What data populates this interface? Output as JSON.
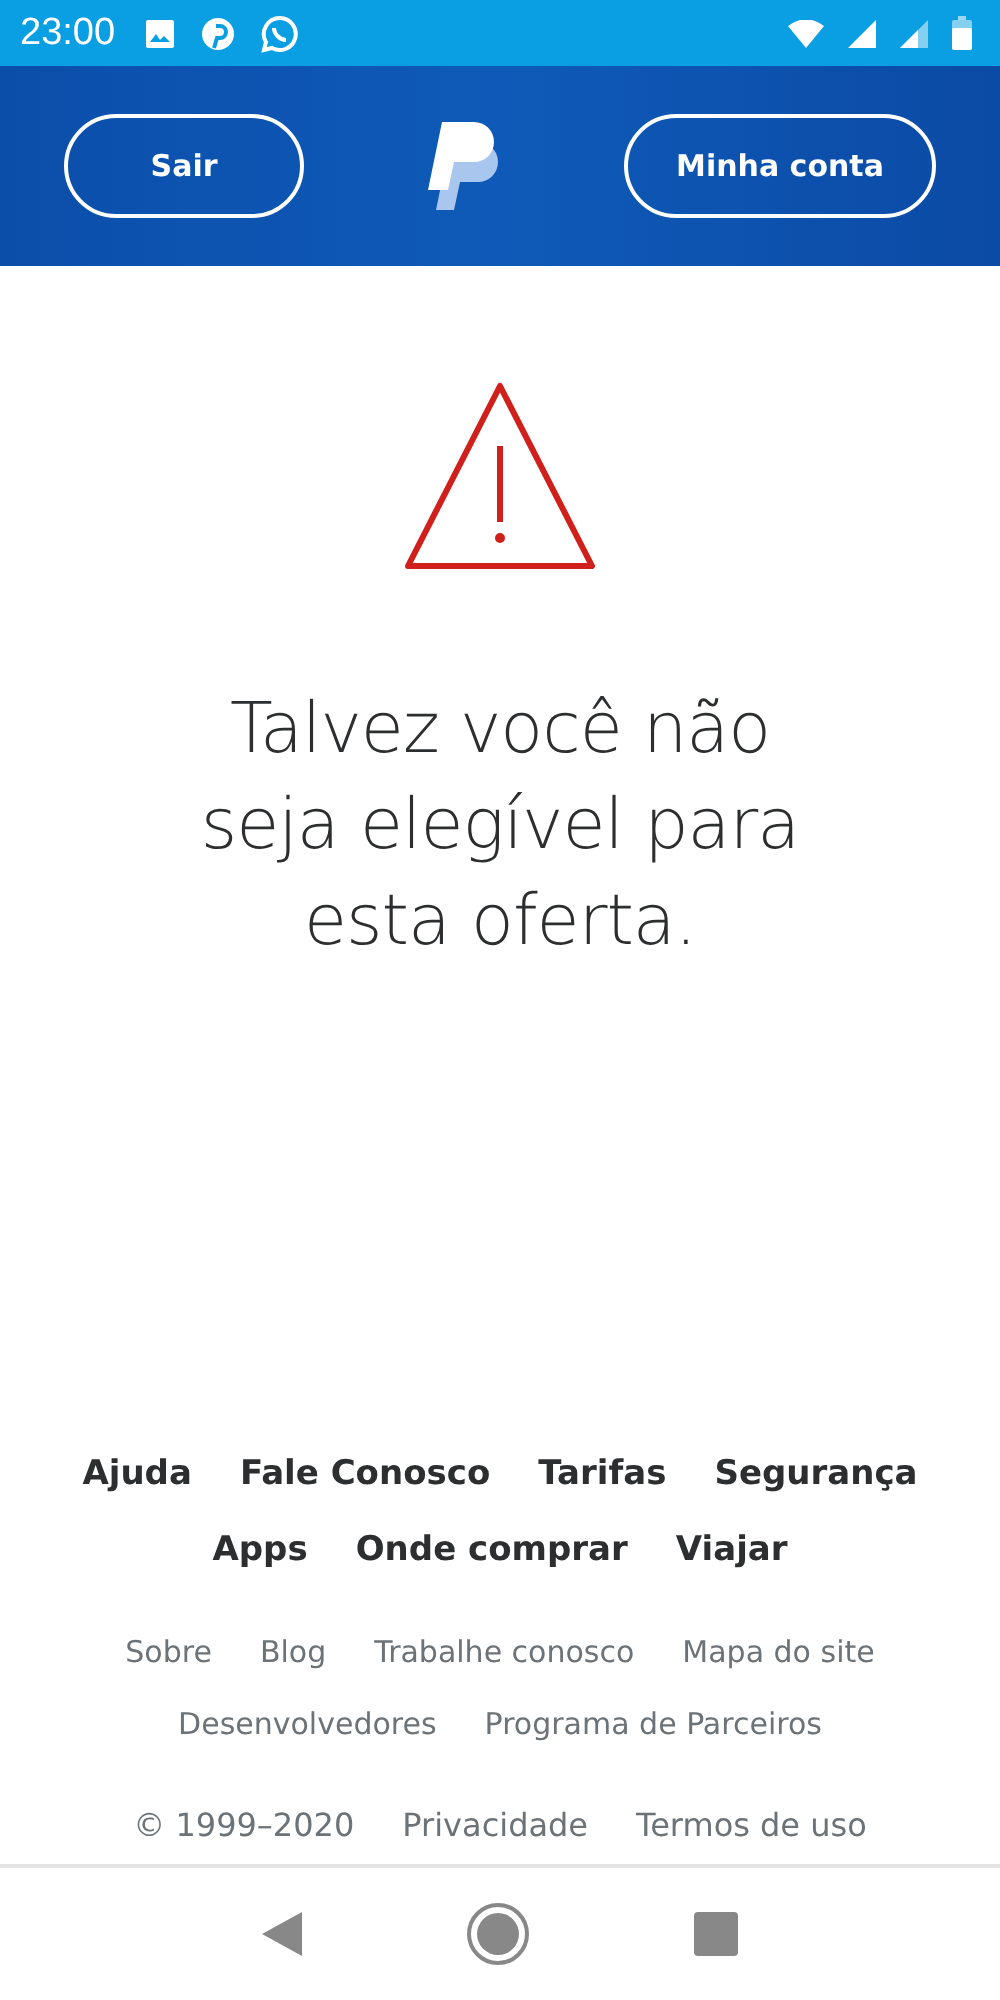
{
  "status_bar": {
    "time": "23:00"
  },
  "header": {
    "buttons": [
      "Sair",
      "Minha conta"
    ]
  },
  "message": "Talvez você não seja elegível para esta oferta.",
  "footer": {
    "primary_links": [
      [
        "Ajuda",
        "Fale Conosco",
        "Tarifas",
        "Segurança"
      ],
      [
        "Apps",
        "Onde comprar",
        "Viajar"
      ]
    ],
    "secondary_links": [
      [
        "Sobre",
        "Blog",
        "Trabalhe conosco",
        "Mapa do site"
      ],
      [
        "Desenvolvedores",
        "Programa de Parceiros"
      ]
    ],
    "copyright": "© 1999–2020",
    "legal_links": [
      "Privacidade",
      "Termos de uso"
    ]
  }
}
